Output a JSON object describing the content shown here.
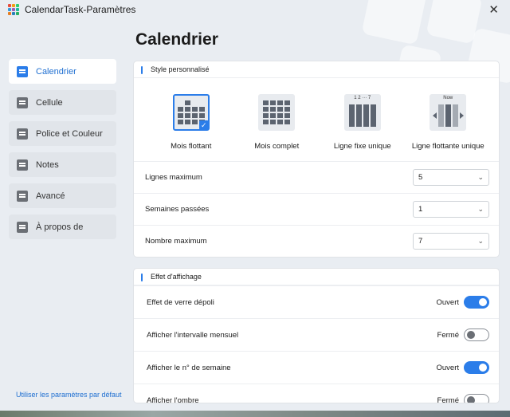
{
  "window": {
    "title": "CalendarTask-Paramètres",
    "close": "✕"
  },
  "page": {
    "title": "Calendrier"
  },
  "sidebar": {
    "items": [
      {
        "label": "Calendrier",
        "active": true
      },
      {
        "label": "Cellule"
      },
      {
        "label": "Police et Couleur"
      },
      {
        "label": "Notes"
      },
      {
        "label": "Avancé"
      },
      {
        "label": "À propos de"
      }
    ],
    "reset_link": "Utiliser les paramètres par défaut"
  },
  "style_section": {
    "header": "Style personnalisé",
    "options": [
      {
        "label": "Mois flottant",
        "selected": true
      },
      {
        "label": "Mois complet"
      },
      {
        "label": "Ligne fixe unique",
        "thumb_text": "1 2 ··· 7"
      },
      {
        "label": "Ligne flottante unique",
        "thumb_text": "Now"
      }
    ],
    "rows": [
      {
        "label": "Lignes maximum",
        "value": "5"
      },
      {
        "label": "Semaines passées",
        "value": "1"
      },
      {
        "label": "Nombre maximum",
        "value": "7"
      }
    ]
  },
  "display_section": {
    "header": "Effet d'affichage",
    "rows": [
      {
        "label": "Effet de verre dépoli",
        "state": "Ouvert",
        "on": true
      },
      {
        "label": "Afficher l'intervalle mensuel",
        "state": "Fermé",
        "on": false
      },
      {
        "label": "Afficher le n° de semaine",
        "state": "Ouvert",
        "on": true
      },
      {
        "label": "Afficher l'ombre",
        "state": "Fermé",
        "on": false
      }
    ]
  },
  "colors": {
    "accent": "#2b7de9",
    "link": "#1f6fd1"
  }
}
